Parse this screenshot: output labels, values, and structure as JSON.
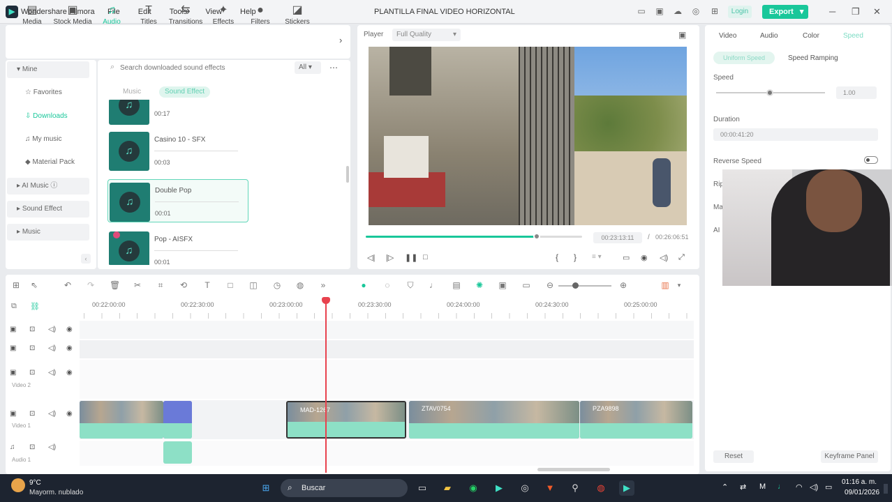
{
  "app": {
    "name": "Wondershare Filmora",
    "document_title": "PLANTILLA FINAL VIDEO HORIZONTAL",
    "login": "Login",
    "export": "Export"
  },
  "menu": [
    "File",
    "Edit",
    "Tools",
    "View",
    "Help"
  ],
  "media_tabs": [
    {
      "label": "Media",
      "icon": "media-icon"
    },
    {
      "label": "Stock Media",
      "icon": "stock-media-icon"
    },
    {
      "label": "Audio",
      "icon": "music-note-icon"
    },
    {
      "label": "Titles",
      "icon": "titles-icon"
    },
    {
      "label": "Transitions",
      "icon": "transitions-icon"
    },
    {
      "label": "Effects",
      "icon": "effects-icon"
    },
    {
      "label": "Filters",
      "icon": "filters-icon"
    },
    {
      "label": "Stickers",
      "icon": "stickers-icon"
    }
  ],
  "sidebar": {
    "items": [
      "Mine",
      "Favorites",
      "Downloads",
      "My music",
      "Material Pack",
      "AI Music",
      "Sound Effect",
      "Music"
    ]
  },
  "search": {
    "placeholder": "Search downloaded sound effects",
    "filter": "All"
  },
  "subtabs": [
    "Music",
    "Sound Effect"
  ],
  "audio_clips": [
    {
      "name": "",
      "dur": "00:17"
    },
    {
      "name": "Casino 10 - SFX",
      "dur": "00:03"
    },
    {
      "name": "Double Pop",
      "dur": "00:01"
    },
    {
      "name": "Pop - AISFX",
      "dur": "00:01"
    }
  ],
  "player": {
    "label": "Player",
    "quality": "Full Quality",
    "current": "00:23:13:11",
    "separator": "/",
    "total": "00:26:06:51",
    "progress": 0.79
  },
  "right": {
    "tabs": [
      "Video",
      "Audio",
      "Color",
      "Speed"
    ],
    "speed_modes": [
      "Uniform Speed",
      "Speed Ramping"
    ],
    "speed_label": "Speed",
    "speed_value": "1.00",
    "duration_label": "Duration",
    "duration_value": "00:00:41:20",
    "reverse_label": "Reverse Speed",
    "partial": [
      "Rip",
      "Ma",
      "AI"
    ],
    "reset": "Reset",
    "keyframe": "Keyframe Panel"
  },
  "ruler": [
    "00:22:00:00",
    "00:22:30:00",
    "00:23:00:00",
    "00:23:30:00",
    "00:24:00:00",
    "00:24:30:00",
    "00:25:00:00"
  ],
  "tracks": {
    "video2": "Video 2",
    "video1": "Video 1",
    "audio1": "Audio 1"
  },
  "clips": [
    "",
    "MAD-1267",
    "ZTAV0754",
    "PZA9898"
  ],
  "taskbar": {
    "temp": "9°C",
    "weather": "Mayorm. nublado",
    "search": "Buscar",
    "time": "01:16 a. m.",
    "date": "09/01/2026"
  }
}
